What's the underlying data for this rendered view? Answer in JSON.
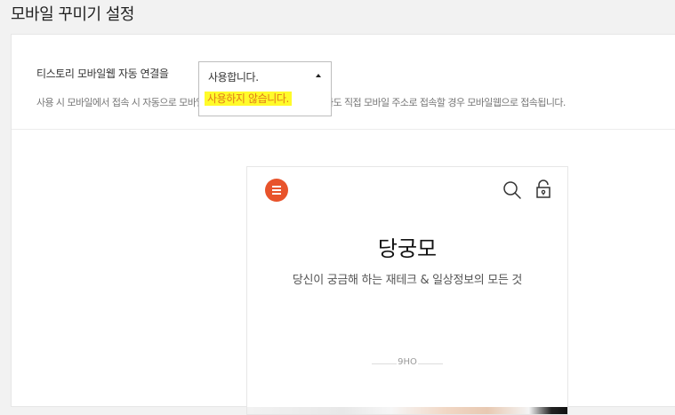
{
  "page": {
    "title": "모바일 꾸미기 설정"
  },
  "setting": {
    "label": "티스토리 모바일웹 자동 연결을",
    "description": "사용 시 모바일에서 접속 시 자동으로 모바일웹으로 연결됩니다. 사용하지 않아도 직접 모바일 주소로 접속할 경우 모바일웹으로 접속됩니다.",
    "dropdown": {
      "selected": "사용합니다.",
      "options": [
        "사용하지 않습니다."
      ],
      "highlight_color": "#fffb2a"
    }
  },
  "preview": {
    "blog_title": "당궁모",
    "blog_description": "당신이 궁금해 하는 재테크 & 일상정보의 모든 것",
    "author": "9HO",
    "icons": [
      "menu-icon",
      "search-icon",
      "lock-icon"
    ],
    "menu_button_color": "#e8532b"
  }
}
